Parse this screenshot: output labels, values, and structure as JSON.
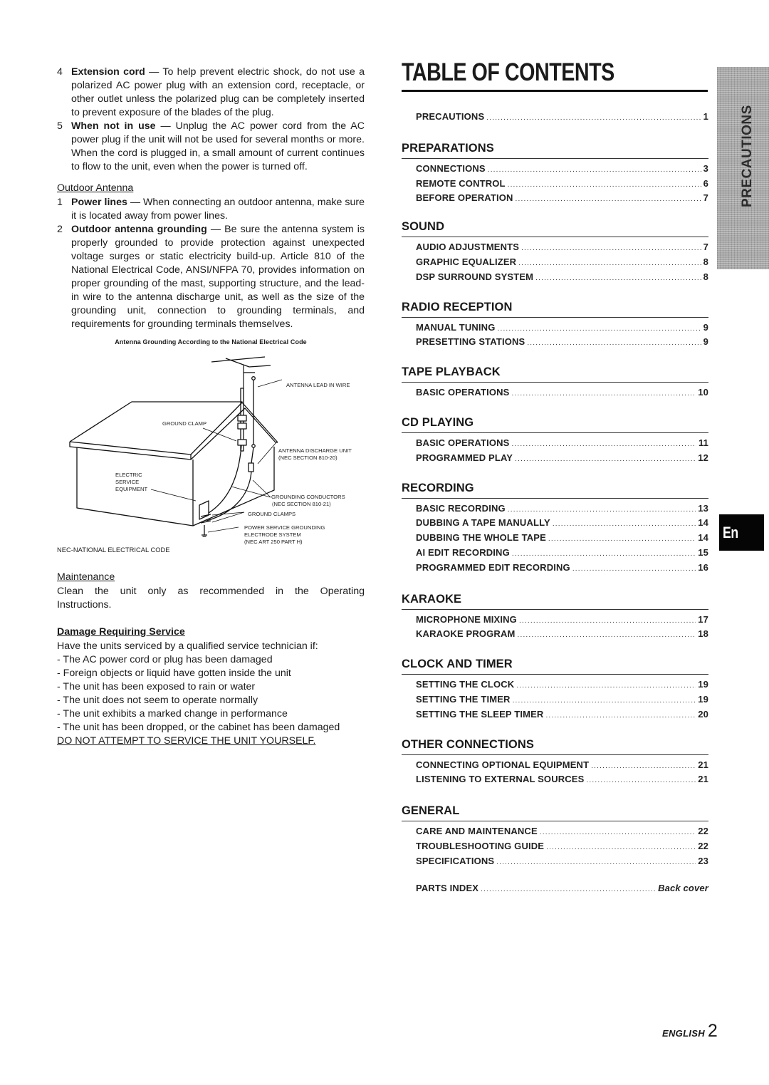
{
  "left": {
    "precaution_items": [
      {
        "num": "4",
        "title": "Extension cord",
        "text": " — To help prevent electric shock, do not use a polarized AC power plug with an extension cord, receptacle, or other outlet unless the polarized plug can be completely inserted to prevent exposure of the blades of the plug."
      },
      {
        "num": "5",
        "title": "When not in use",
        "text": " — Unplug the AC power cord from the AC power plug if the unit will not be used for several months or more.  When the cord is plugged in, a small amount of current continues to flow to the unit, even when the power is turned off."
      }
    ],
    "outdoor_antenna": {
      "heading": "Outdoor Antenna",
      "items": [
        {
          "num": "1",
          "title": "Power lines",
          "text": " — When connecting an outdoor antenna, make sure it is located away from power lines."
        },
        {
          "num": "2",
          "title": "Outdoor antenna grounding",
          "text": " — Be sure the antenna system is properly grounded to provide protection against unexpected voltage surges or static electricity build-up.  Article 810 of the National Electrical Code, ANSI/NFPA 70, provides information on proper grounding of the mast, supporting structure, and the lead-in wire to the antenna discharge unit, as well as the size of the grounding unit, connection to grounding terminals, and requirements for grounding terminals themselves."
        }
      ]
    },
    "diagram": {
      "caption": "Antenna Grounding According to the National Electrical Code",
      "labels": {
        "antenna_lead_in_wire": "ANTENNA LEAD IN WIRE",
        "ground_clamp": "GROUND CLAMP",
        "antenna_discharge_unit": "ANTENNA DISCHARGE UNIT",
        "antenna_discharge_unit_ref": "(NEC SECTION 810-20)",
        "electric_service_1": "ELECTRIC",
        "electric_service_2": "SERVICE",
        "electric_service_3": "EQUIPMENT",
        "grounding_conductors": "GROUNDING CONDUCTORS",
        "grounding_conductors_ref": "(NEC SECTION 810-21)",
        "ground_clamps": "GROUND CLAMPS",
        "power_service_1": "POWER SERVICE GROUNDING",
        "power_service_2": "ELECTRODE SYSTEM",
        "power_service_3": "(NEC ART 250 PART H)"
      },
      "footnote": "NEC-NATIONAL ELECTRICAL CODE"
    },
    "maintenance": {
      "heading": "Maintenance",
      "line1": "Clean the unit only as recommended in the Operating",
      "line2": "Instructions."
    },
    "damage": {
      "heading": "Damage Requiring Service",
      "intro": "Have the units serviced by a qualified service technician if:",
      "items": [
        "- The AC power cord or plug has been damaged",
        "- Foreign objects or liquid have gotten inside the unit",
        "- The unit has been exposed to rain or water",
        "- The unit does not seem to operate normally",
        "- The unit exhibits a marked change in performance",
        "- The unit has been dropped, or the cabinet has been damaged"
      ],
      "warning": "DO NOT ATTEMPT TO SERVICE THE UNIT YOURSELF."
    }
  },
  "toc": {
    "title": "TABLE OF CONTENTS",
    "top_entry": {
      "label": "PRECAUTIONS",
      "page": "1"
    },
    "sections": [
      {
        "heading": "PREPARATIONS",
        "entries": [
          {
            "label": "CONNECTIONS",
            "page": "3"
          },
          {
            "label": "REMOTE CONTROL",
            "page": "6"
          },
          {
            "label": "BEFORE OPERATION",
            "page": "7"
          }
        ]
      },
      {
        "heading": "SOUND",
        "entries": [
          {
            "label": "AUDIO ADJUSTMENTS",
            "page": "7"
          },
          {
            "label": "GRAPHIC EQUALIZER",
            "page": "8"
          },
          {
            "label": "DSP SURROUND SYSTEM",
            "page": "8"
          }
        ]
      },
      {
        "heading": "RADIO RECEPTION",
        "entries": [
          {
            "label": "MANUAL TUNING",
            "page": "9"
          },
          {
            "label": "PRESETTING STATIONS",
            "page": "9"
          }
        ]
      },
      {
        "heading": "TAPE PLAYBACK",
        "entries": [
          {
            "label": "BASIC OPERATIONS",
            "page": "10"
          }
        ]
      },
      {
        "heading": "CD PLAYING",
        "entries": [
          {
            "label": "BASIC OPERATIONS",
            "page": "11"
          },
          {
            "label": "PROGRAMMED PLAY",
            "page": "12"
          }
        ]
      },
      {
        "heading": "RECORDING",
        "entries": [
          {
            "label": "BASIC RECORDING",
            "page": "13"
          },
          {
            "label": "DUBBING A TAPE MANUALLY",
            "page": "14"
          },
          {
            "label": "DUBBING THE WHOLE TAPE",
            "page": "14"
          },
          {
            "label": "AI EDIT RECORDING",
            "page": "15"
          },
          {
            "label": "PROGRAMMED EDIT RECORDING",
            "page": "16"
          }
        ]
      },
      {
        "heading": "KARAOKE",
        "entries": [
          {
            "label": "MICROPHONE MIXING",
            "page": "17"
          },
          {
            "label": "KARAOKE PROGRAM",
            "page": "18"
          }
        ]
      },
      {
        "heading": "CLOCK AND TIMER",
        "entries": [
          {
            "label": "SETTING THE CLOCK",
            "page": "19"
          },
          {
            "label": "SETTING THE TIMER",
            "page": "19"
          },
          {
            "label": "SETTING THE SLEEP TIMER",
            "page": "20"
          }
        ]
      },
      {
        "heading": "OTHER CONNECTIONS",
        "entries": [
          {
            "label": "CONNECTING OPTIONAL EQUIPMENT",
            "page": "21"
          },
          {
            "label": "LISTENING TO EXTERNAL SOURCES",
            "page": "21"
          }
        ]
      },
      {
        "heading": "GENERAL",
        "entries": [
          {
            "label": "CARE AND MAINTENANCE",
            "page": "22"
          },
          {
            "label": "TROUBLESHOOTING GUIDE",
            "page": "22"
          },
          {
            "label": "SPECIFICATIONS",
            "page": "23"
          }
        ]
      }
    ],
    "bottom_entry": {
      "label": "PARTS INDEX",
      "page": "Back cover"
    }
  },
  "side_tabs": {
    "section_tab": "PRECAUTIONS",
    "language_tab": "En"
  },
  "footer": {
    "language": "ENGLISH",
    "page_number": "2"
  }
}
